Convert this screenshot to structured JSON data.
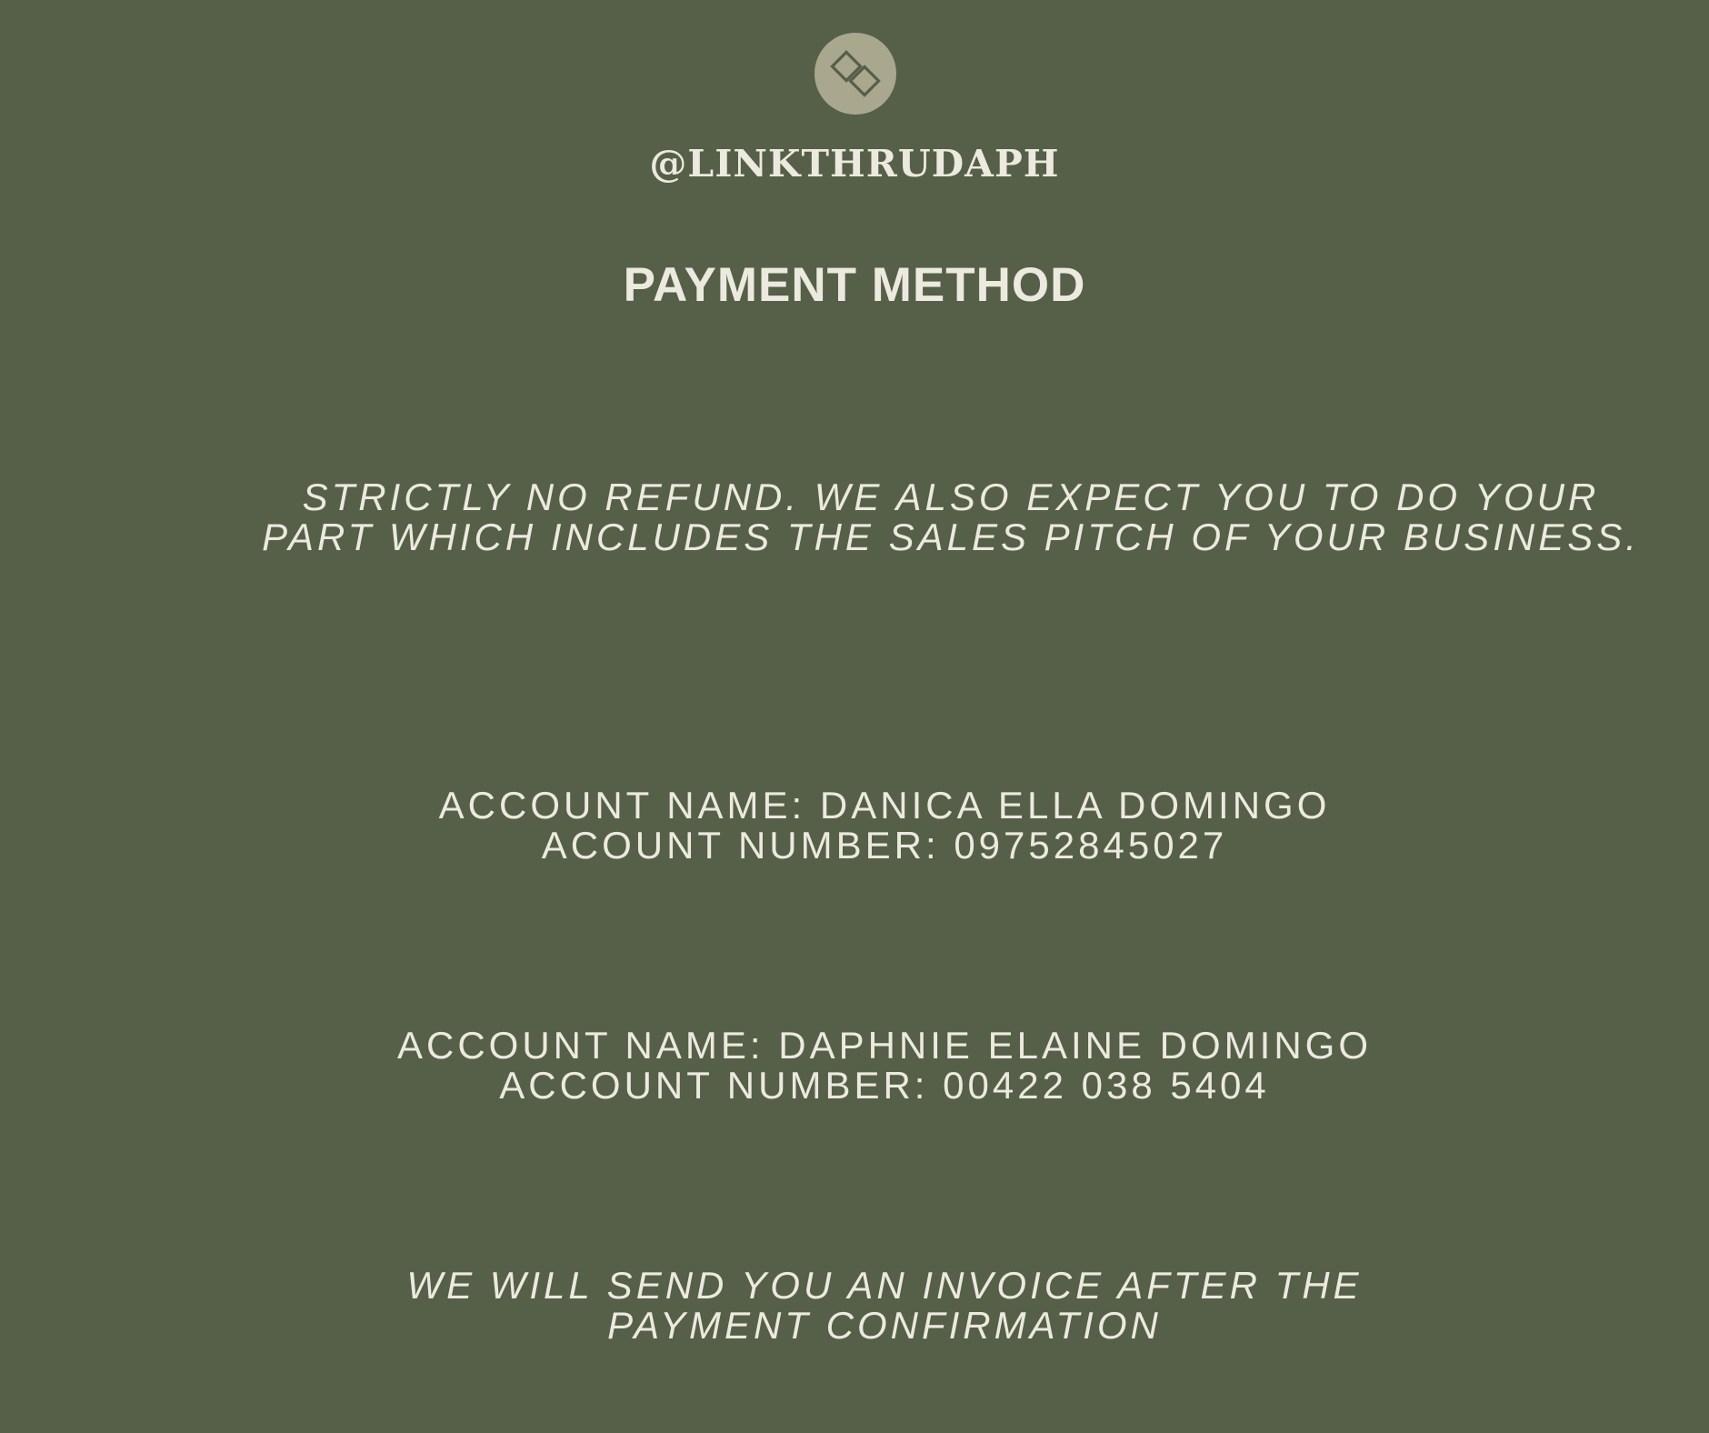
{
  "brand": {
    "icon": "chain-link-icon",
    "handle": "@LINKTHRUDAPH"
  },
  "heading": {
    "title": "PAYMENT METHOD"
  },
  "notice": {
    "lines": [
      "STRICTLY NO REFUND. WE ALSO EXPECT YOU TO DO YOUR",
      "PART WHICH INCLUDES THE SALES PITCH OF YOUR BUSINESS."
    ]
  },
  "accounts": [
    {
      "name_line": "ACCOUNT NAME: DANICA ELLA DOMINGO",
      "number_line": "ACOUNT NUMBER: 09752845027"
    },
    {
      "name_line": "ACCOUNT NAME: DAPHNIE ELAINE DOMINGO",
      "number_line": "ACCOUNT NUMBER: 00422 038 5404"
    }
  ],
  "invoice": {
    "lines": [
      "WE WILL SEND YOU AN INVOICE AFTER THE",
      "PAYMENT CONFIRMATION"
    ]
  },
  "colors": {
    "background": "#565f48",
    "text": "#ece9df",
    "logo_circle": "#a9a88f",
    "logo_mark": "#565f48"
  }
}
